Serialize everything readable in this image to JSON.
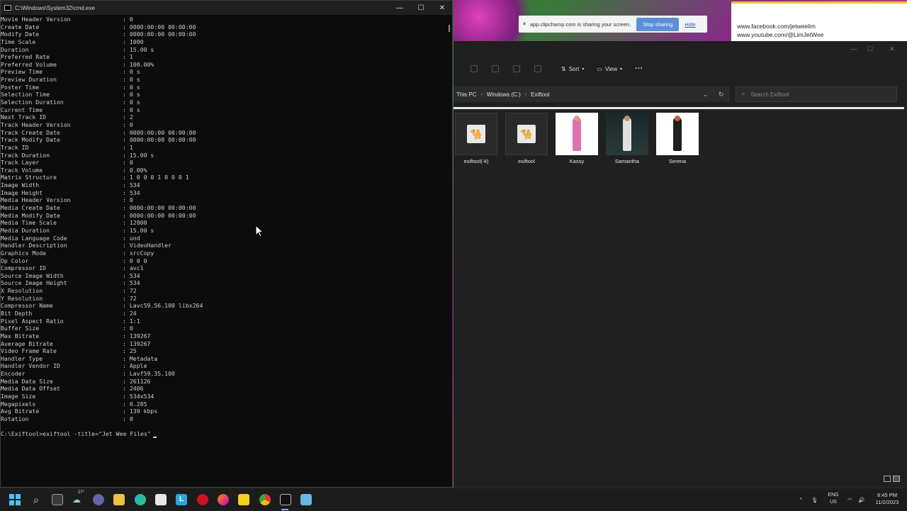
{
  "cmd": {
    "title": "C:\\Windows\\System32\\cmd.exe",
    "lines": [
      {
        "k": "Movie Header Version",
        "v": ": 0"
      },
      {
        "k": "Create Date",
        "v": ": 0000:00:00 00:00:00"
      },
      {
        "k": "Modify Date",
        "v": ": 0000:00:00 00:00:00"
      },
      {
        "k": "Time Scale",
        "v": ": 1000"
      },
      {
        "k": "Duration",
        "v": ": 15.00 s"
      },
      {
        "k": "Preferred Rate",
        "v": ": 1"
      },
      {
        "k": "Preferred Volume",
        "v": ": 100.00%"
      },
      {
        "k": "Preview Time",
        "v": ": 0 s"
      },
      {
        "k": "Preview Duration",
        "v": ": 0 s"
      },
      {
        "k": "Poster Time",
        "v": ": 0 s"
      },
      {
        "k": "Selection Time",
        "v": ": 0 s"
      },
      {
        "k": "Selection Duration",
        "v": ": 0 s"
      },
      {
        "k": "Current Time",
        "v": ": 0 s"
      },
      {
        "k": "Next Track ID",
        "v": ": 2"
      },
      {
        "k": "Track Header Version",
        "v": ": 0"
      },
      {
        "k": "Track Create Date",
        "v": ": 0000:00:00 00:00:00"
      },
      {
        "k": "Track Modify Date",
        "v": ": 0000:00:00 00:00:00"
      },
      {
        "k": "Track ID",
        "v": ": 1"
      },
      {
        "k": "Track Duration",
        "v": ": 15.00 s"
      },
      {
        "k": "Track Layer",
        "v": ": 0"
      },
      {
        "k": "Track Volume",
        "v": ": 0.00%"
      },
      {
        "k": "Matrix Structure",
        "v": ": 1 0 0 0 1 0 0 0 1"
      },
      {
        "k": "Image Width",
        "v": ": 534"
      },
      {
        "k": "Image Height",
        "v": ": 534"
      },
      {
        "k": "Media Header Version",
        "v": ": 0"
      },
      {
        "k": "Media Create Date",
        "v": ": 0000:00:00 00:00:00"
      },
      {
        "k": "Media Modify Date",
        "v": ": 0000:00:00 00:00:00"
      },
      {
        "k": "Media Time Scale",
        "v": ": 12800"
      },
      {
        "k": "Media Duration",
        "v": ": 15.00 s"
      },
      {
        "k": "Media Language Code",
        "v": ": und"
      },
      {
        "k": "Handler Description",
        "v": ": VideoHandler"
      },
      {
        "k": "Graphics Mode",
        "v": ": srcCopy"
      },
      {
        "k": "Op Color",
        "v": ": 0 0 0"
      },
      {
        "k": "Compressor ID",
        "v": ": avc1"
      },
      {
        "k": "Source Image Width",
        "v": ": 534"
      },
      {
        "k": "Source Image Height",
        "v": ": 534"
      },
      {
        "k": "X Resolution",
        "v": ": 72"
      },
      {
        "k": "Y Resolution",
        "v": ": 72"
      },
      {
        "k": "Compressor Name",
        "v": ": Lavc59.56.100 libx264"
      },
      {
        "k": "Bit Depth",
        "v": ": 24"
      },
      {
        "k": "Pixel Aspect Ratio",
        "v": ": 1:1"
      },
      {
        "k": "Buffer Size",
        "v": ": 0"
      },
      {
        "k": "Max Bitrate",
        "v": ": 139267"
      },
      {
        "k": "Average Bitrate",
        "v": ": 139267"
      },
      {
        "k": "Video Frame Rate",
        "v": ": 25"
      },
      {
        "k": "Handler Type",
        "v": ": Metadata"
      },
      {
        "k": "Handler Vendor ID",
        "v": ": Apple"
      },
      {
        "k": "Encoder",
        "v": ": Lavf59.35.100"
      },
      {
        "k": "Media Data Size",
        "v": ": 261126"
      },
      {
        "k": "Media Data Offset",
        "v": ": 2406"
      },
      {
        "k": "Image Size",
        "v": ": 534x534"
      },
      {
        "k": "Megapixels",
        "v": ": 0.285"
      },
      {
        "k": "Avg Bitrate",
        "v": ": 139 kbps"
      },
      {
        "k": "Rotation",
        "v": ": 0"
      },
      {
        "k": "",
        "v": ""
      },
      {
        "k": "",
        "v": "C:\\Exiftool>exiftool -title=\"Jet Wee Files\""
      }
    ]
  },
  "sharing": {
    "message": "app.clipchamp.com is sharing your screen.",
    "stop_label": "Stop sharing",
    "hide_label": "Hide"
  },
  "social": {
    "line1": "www.facebook.com/jetweelim",
    "line2": "www.youtube.com/@LimJetWee"
  },
  "explorer": {
    "toolbar": {
      "sort_label": "Sort",
      "view_label": "View",
      "more_label": "···"
    },
    "breadcrumb": [
      "This PC",
      "Windows (C:)",
      "Exiftool"
    ],
    "search_placeholder": "Search Exiftool",
    "files": [
      {
        "name": "exiftool(-k)",
        "kind": "doc"
      },
      {
        "name": "exiftool",
        "kind": "doc"
      },
      {
        "name": "Kassy",
        "kind": "photo"
      },
      {
        "name": "Samantha",
        "kind": "photo-dark"
      },
      {
        "name": "Serena",
        "kind": "photo"
      }
    ]
  },
  "taskbar": {
    "weather": "27°",
    "lang_line1": "ENG",
    "lang_line2": "US",
    "time": "8:45 PM",
    "date": "11/2/2023"
  },
  "colors": {
    "accent": "#5b8fd8",
    "terminal_bg": "#0c0c0c",
    "explorer_bg": "#202020"
  }
}
